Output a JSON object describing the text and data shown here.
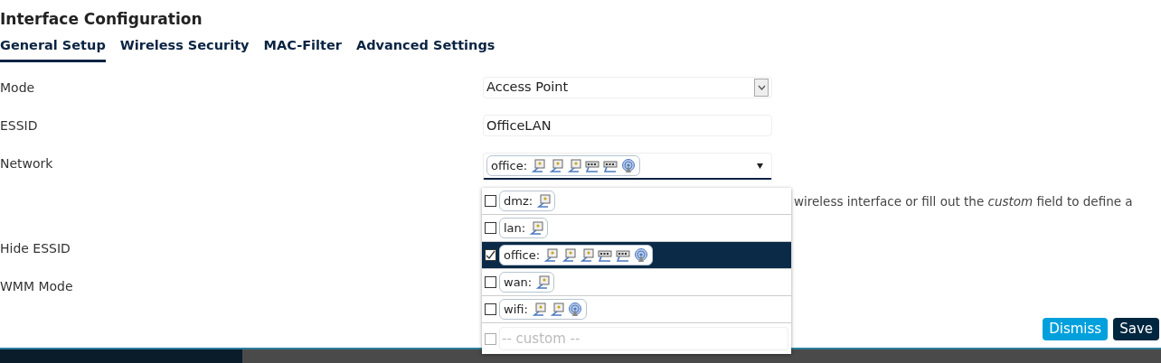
{
  "title": "Interface Configuration",
  "tabs": [
    {
      "label": "General Setup",
      "selected": true
    },
    {
      "label": "Wireless Security",
      "selected": false
    },
    {
      "label": "MAC-Filter",
      "selected": false
    },
    {
      "label": "Advanced Settings",
      "selected": false
    }
  ],
  "fields": [
    {
      "label": "Mode",
      "kind": "select",
      "value": "Access Point"
    },
    {
      "label": "ESSID",
      "kind": "text",
      "value": "OfficeLAN"
    },
    {
      "label": "Network",
      "kind": "network",
      "value": {
        "name": "office:",
        "devices": [
          {
            "kind": "port"
          },
          {
            "kind": "port"
          },
          {
            "kind": "port"
          },
          {
            "kind": "switch"
          },
          {
            "kind": "switch"
          },
          {
            "kind": "wireless"
          }
        ]
      },
      "help": "wireless interface or fill out the *custom* field to define a"
    },
    {
      "label": "Hide ESSID",
      "kind": "blank"
    },
    {
      "label": "WMM Mode",
      "kind": "blank"
    }
  ],
  "network_options": [
    {
      "name": "dmz:",
      "devices": [
        {
          "kind": "port"
        }
      ],
      "checked": false,
      "selected": false
    },
    {
      "name": "lan:",
      "devices": [
        {
          "kind": "port"
        }
      ],
      "checked": false,
      "selected": false
    },
    {
      "name": "office:",
      "devices": [
        {
          "kind": "port"
        },
        {
          "kind": "port"
        },
        {
          "kind": "port"
        },
        {
          "kind": "switch"
        },
        {
          "kind": "switch"
        },
        {
          "kind": "wireless"
        }
      ],
      "checked": true,
      "selected": true
    },
    {
      "name": "wan:",
      "devices": [
        {
          "kind": "port"
        }
      ],
      "checked": false,
      "selected": false
    },
    {
      "name": "wifi:",
      "devices": [
        {
          "kind": "port"
        },
        {
          "kind": "port"
        },
        {
          "kind": "wireless"
        }
      ],
      "checked": false,
      "selected": false
    }
  ],
  "custom": {
    "placeholder": "-- custom --",
    "checked": false
  },
  "buttons": [
    {
      "label": "Dismiss",
      "kind": "secondary"
    },
    {
      "label": "Save",
      "kind": "primary"
    }
  ]
}
